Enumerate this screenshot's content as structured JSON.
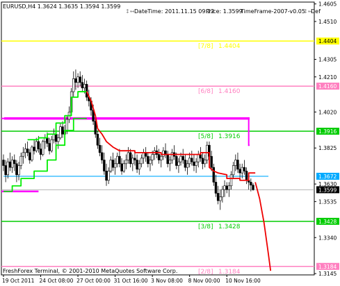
{
  "header": {
    "symbol_line": "EURUSD,H4  1.3624 1.3635 1.3594 1.3599",
    "datetime": "DateTime: 2011.11.15 09:22",
    "price": "Price: 1.3599",
    "timeframe": "TimeFrame-2007-v0.05",
    "extra": "Def"
  },
  "footer": {
    "copyright": "FreshForex Terminal, © 2001-2010 MetaQuotes Software Corp."
  },
  "colors": {
    "background": "#ffffff",
    "candles": "#000000",
    "murrey_78": "#ffff00",
    "murrey_68": "#ff80c0",
    "murrey_58": "#00cc00",
    "murrey_38": "#00cc00",
    "murrey_28": "#ff80c0",
    "magenta_band": "#ff00ff",
    "cyan_line": "#00aaff",
    "trailing_green": "#00ee00",
    "trailing_red": "#ee0000",
    "price_line": "#aaaaaa"
  },
  "chart_data": {
    "type": "candlestick",
    "symbol": "EURUSD",
    "timeframe": "H4",
    "ohlc_current": {
      "open": 1.3624,
      "high": 1.3635,
      "low": 1.3594,
      "close": 1.3599
    },
    "ylim": [
      1.3138,
      1.4615
    ],
    "y_ticks": [
      "1.4605",
      "1.4510",
      "1.4305",
      "1.4210",
      "1.4020",
      "1.3825",
      "1.3630",
      "1.3535",
      "1.3340",
      "1.3145"
    ],
    "x_ticks": [
      "19 Oct 2011",
      "24 Oct 08:00",
      "27 Oct 00:00",
      "31 Oct 16:00",
      "3 Nov 08:00",
      "8 Nov 00:00",
      "10 Nov 16:00"
    ],
    "murrey_levels": [
      {
        "label": "[7/8]",
        "value": 1.4404,
        "value_text": "1.4404",
        "color": "#ffff00"
      },
      {
        "label": "[6/8]",
        "value": 1.416,
        "value_text": "1.4160",
        "color": "#ff80c0"
      },
      {
        "label": "[5/8]",
        "value": 1.3916,
        "value_text": "1.3916",
        "color": "#00cc00"
      },
      {
        "label": "[3/8]",
        "value": 1.3428,
        "value_text": "1.3428",
        "color": "#00cc00"
      },
      {
        "label": "[2/8]",
        "value": 1.3184,
        "value_text": "1.3184",
        "color": "#ff80c0"
      }
    ],
    "price_tags": [
      {
        "value": 1.4404,
        "text": "1.4404",
        "bg": "#ffff00",
        "fg": "#000000"
      },
      {
        "value": 1.416,
        "text": "1.4160",
        "bg": "#ff80c0",
        "fg": "#ffffff"
      },
      {
        "value": 1.3916,
        "text": "1.3916",
        "bg": "#00cc00",
        "fg": "#ffffff"
      },
      {
        "value": 1.3672,
        "text": "1.3672",
        "bg": "#00aaff",
        "fg": "#ffffff"
      },
      {
        "value": 1.3599,
        "text": "1.3599",
        "bg": "#000000",
        "fg": "#ffffff"
      },
      {
        "value": 1.3428,
        "text": "1.3428",
        "bg": "#00cc00",
        "fg": "#ffffff"
      },
      {
        "value": 1.3184,
        "text": "1.3184",
        "bg": "#ff80c0",
        "fg": "#ffffff"
      }
    ],
    "magenta_band": {
      "value": 1.3985,
      "step_down": {
        "value": 1.384,
        "from_bar": 112
      },
      "left_stub": {
        "value": 1.359,
        "to_bar": 16
      }
    },
    "cyan_level": {
      "value": 1.3672,
      "from_bar": 0,
      "to_bar": 121
    },
    "current_price": 1.3599,
    "candles": [
      [
        1.376,
        1.379,
        1.37,
        1.373
      ],
      [
        1.373,
        1.376,
        1.364,
        1.368
      ],
      [
        1.368,
        1.377,
        1.366,
        1.375
      ],
      [
        1.375,
        1.38,
        1.37,
        1.372
      ],
      [
        1.372,
        1.378,
        1.369,
        1.376
      ],
      [
        1.376,
        1.379,
        1.37,
        1.374
      ],
      [
        1.374,
        1.376,
        1.364,
        1.368
      ],
      [
        1.368,
        1.375,
        1.365,
        1.373
      ],
      [
        1.373,
        1.38,
        1.371,
        1.378
      ],
      [
        1.378,
        1.383,
        1.374,
        1.38
      ],
      [
        1.38,
        1.385,
        1.377,
        1.382
      ],
      [
        1.382,
        1.386,
        1.378,
        1.38
      ],
      [
        1.38,
        1.382,
        1.374,
        1.376
      ],
      [
        1.376,
        1.384,
        1.375,
        1.383
      ],
      [
        1.383,
        1.387,
        1.379,
        1.381
      ],
      [
        1.381,
        1.388,
        1.38,
        1.386
      ],
      [
        1.386,
        1.389,
        1.38,
        1.382
      ],
      [
        1.382,
        1.385,
        1.376,
        1.379
      ],
      [
        1.379,
        1.387,
        1.378,
        1.386
      ],
      [
        1.386,
        1.39,
        1.382,
        1.388
      ],
      [
        1.388,
        1.391,
        1.383,
        1.385
      ],
      [
        1.385,
        1.388,
        1.379,
        1.381
      ],
      [
        1.381,
        1.389,
        1.38,
        1.387
      ],
      [
        1.387,
        1.393,
        1.385,
        1.39
      ],
      [
        1.39,
        1.392,
        1.384,
        1.386
      ],
      [
        1.386,
        1.39,
        1.382,
        1.388
      ],
      [
        1.388,
        1.396,
        1.387,
        1.394
      ],
      [
        1.394,
        1.397,
        1.388,
        1.39
      ],
      [
        1.39,
        1.395,
        1.387,
        1.392
      ],
      [
        1.392,
        1.4,
        1.39,
        1.398
      ],
      [
        1.398,
        1.405,
        1.396,
        1.402
      ],
      [
        1.402,
        1.415,
        1.4,
        1.413
      ],
      [
        1.413,
        1.424,
        1.41,
        1.42
      ],
      [
        1.42,
        1.425,
        1.414,
        1.418
      ],
      [
        1.418,
        1.423,
        1.415,
        1.421
      ],
      [
        1.421,
        1.424,
        1.416,
        1.418
      ],
      [
        1.418,
        1.422,
        1.413,
        1.415
      ],
      [
        1.415,
        1.42,
        1.412,
        1.417
      ],
      [
        1.417,
        1.419,
        1.408,
        1.41
      ],
      [
        1.41,
        1.414,
        1.405,
        1.408
      ],
      [
        1.408,
        1.41,
        1.4,
        1.403
      ],
      [
        1.403,
        1.406,
        1.395,
        1.397
      ],
      [
        1.397,
        1.399,
        1.388,
        1.39
      ],
      [
        1.39,
        1.392,
        1.382,
        1.384
      ],
      [
        1.384,
        1.388,
        1.378,
        1.38
      ],
      [
        1.38,
        1.384,
        1.374,
        1.376
      ],
      [
        1.376,
        1.38,
        1.368,
        1.37
      ],
      [
        1.37,
        1.374,
        1.362,
        1.365
      ],
      [
        1.365,
        1.372,
        1.363,
        1.37
      ],
      [
        1.37,
        1.378,
        1.369,
        1.376
      ],
      [
        1.376,
        1.38,
        1.37,
        1.372
      ],
      [
        1.372,
        1.377,
        1.368,
        1.374
      ],
      [
        1.374,
        1.38,
        1.372,
        1.378
      ],
      [
        1.378,
        1.382,
        1.372,
        1.374
      ],
      [
        1.374,
        1.377,
        1.368,
        1.37
      ],
      [
        1.37,
        1.376,
        1.369,
        1.374
      ],
      [
        1.374,
        1.379,
        1.371,
        1.376
      ],
      [
        1.376,
        1.383,
        1.374,
        1.38
      ],
      [
        1.38,
        1.382,
        1.372,
        1.374
      ],
      [
        1.374,
        1.379,
        1.37,
        1.377
      ],
      [
        1.377,
        1.381,
        1.373,
        1.376
      ],
      [
        1.376,
        1.379,
        1.369,
        1.371
      ],
      [
        1.371,
        1.376,
        1.368,
        1.374
      ],
      [
        1.374,
        1.379,
        1.372,
        1.377
      ],
      [
        1.377,
        1.382,
        1.374,
        1.38
      ],
      [
        1.38,
        1.383,
        1.375,
        1.378
      ],
      [
        1.378,
        1.38,
        1.372,
        1.374
      ],
      [
        1.374,
        1.378,
        1.37,
        1.376
      ],
      [
        1.376,
        1.381,
        1.373,
        1.379
      ],
      [
        1.379,
        1.383,
        1.376,
        1.381
      ],
      [
        1.381,
        1.384,
        1.377,
        1.379
      ],
      [
        1.379,
        1.382,
        1.374,
        1.376
      ],
      [
        1.376,
        1.38,
        1.372,
        1.378
      ],
      [
        1.378,
        1.383,
        1.376,
        1.381
      ],
      [
        1.381,
        1.385,
        1.377,
        1.379
      ],
      [
        1.379,
        1.381,
        1.372,
        1.374
      ],
      [
        1.374,
        1.378,
        1.37,
        1.376
      ],
      [
        1.376,
        1.382,
        1.374,
        1.38
      ],
      [
        1.38,
        1.384,
        1.376,
        1.378
      ],
      [
        1.378,
        1.38,
        1.371,
        1.373
      ],
      [
        1.373,
        1.377,
        1.369,
        1.375
      ],
      [
        1.375,
        1.38,
        1.373,
        1.378
      ],
      [
        1.378,
        1.382,
        1.374,
        1.376
      ],
      [
        1.376,
        1.379,
        1.37,
        1.372
      ],
      [
        1.372,
        1.376,
        1.368,
        1.374
      ],
      [
        1.374,
        1.38,
        1.372,
        1.377
      ],
      [
        1.377,
        1.381,
        1.373,
        1.375
      ],
      [
        1.375,
        1.379,
        1.37,
        1.373
      ],
      [
        1.373,
        1.377,
        1.369,
        1.375
      ],
      [
        1.375,
        1.381,
        1.372,
        1.379
      ],
      [
        1.379,
        1.383,
        1.375,
        1.377
      ],
      [
        1.377,
        1.38,
        1.371,
        1.374
      ],
      [
        1.374,
        1.379,
        1.372,
        1.376
      ],
      [
        1.376,
        1.386,
        1.374,
        1.384
      ],
      [
        1.384,
        1.386,
        1.376,
        1.378
      ],
      [
        1.378,
        1.381,
        1.37,
        1.372
      ],
      [
        1.372,
        1.374,
        1.362,
        1.364
      ],
      [
        1.364,
        1.368,
        1.356,
        1.358
      ],
      [
        1.358,
        1.362,
        1.352,
        1.354
      ],
      [
        1.354,
        1.36,
        1.349,
        1.356
      ],
      [
        1.356,
        1.362,
        1.353,
        1.36
      ],
      [
        1.36,
        1.365,
        1.356,
        1.362
      ],
      [
        1.362,
        1.364,
        1.358,
        1.36
      ],
      [
        1.36,
        1.364,
        1.356,
        1.362
      ],
      [
        1.362,
        1.37,
        1.36,
        1.368
      ],
      [
        1.368,
        1.375,
        1.366,
        1.373
      ],
      [
        1.373,
        1.379,
        1.37,
        1.376
      ],
      [
        1.376,
        1.38,
        1.369,
        1.371
      ],
      [
        1.371,
        1.374,
        1.365,
        1.369
      ],
      [
        1.369,
        1.374,
        1.366,
        1.372
      ],
      [
        1.372,
        1.376,
        1.368,
        1.37
      ],
      [
        1.37,
        1.372,
        1.363,
        1.365
      ],
      [
        1.365,
        1.368,
        1.36,
        1.364
      ],
      [
        1.364,
        1.366,
        1.359,
        1.3624
      ],
      [
        1.3624,
        1.3635,
        1.3594,
        1.3599
      ]
    ],
    "trailing_stop": [
      {
        "color": "#00ee00",
        "points": [
          [
            11,
            1.387
          ],
          [
            16,
            1.387
          ],
          [
            16,
            1.388
          ],
          [
            20,
            1.388
          ],
          [
            20,
            1.39
          ],
          [
            24,
            1.39
          ],
          [
            24,
            1.396
          ],
          [
            28,
            1.396
          ],
          [
            28,
            1.4
          ],
          [
            31,
            1.4
          ],
          [
            31,
            1.41
          ],
          [
            34,
            1.41
          ],
          [
            34,
            1.413
          ],
          [
            38,
            1.413
          ]
        ]
      },
      {
        "color": "#00ee00",
        "points": [
          [
            0,
            1.359
          ],
          [
            4,
            1.359
          ],
          [
            4,
            1.362
          ],
          [
            8,
            1.362
          ],
          [
            8,
            1.366
          ],
          [
            14,
            1.366
          ],
          [
            14,
            1.37
          ],
          [
            20,
            1.37
          ],
          [
            20,
            1.376
          ],
          [
            24,
            1.376
          ],
          [
            24,
            1.384
          ],
          [
            28,
            1.384
          ],
          [
            28,
            1.392
          ],
          [
            32,
            1.392
          ],
          [
            32,
            1.3985
          ],
          [
            38,
            1.3985
          ]
        ]
      },
      {
        "color": "#ee0000",
        "points": [
          [
            38,
            1.413
          ],
          [
            40,
            1.408
          ],
          [
            42,
            1.4
          ],
          [
            43,
            1.393
          ],
          [
            45,
            1.39
          ],
          [
            47,
            1.386
          ],
          [
            50,
            1.383
          ],
          [
            53,
            1.381
          ],
          [
            60,
            1.381
          ],
          [
            60,
            1.38
          ],
          [
            72,
            1.38
          ],
          [
            72,
            1.379
          ],
          [
            90,
            1.379
          ],
          [
            90,
            1.38
          ],
          [
            94,
            1.38
          ],
          [
            94,
            1.372
          ],
          [
            96,
            1.37
          ],
          [
            98,
            1.369
          ],
          [
            102,
            1.368
          ],
          [
            102,
            1.366
          ],
          [
            108,
            1.366
          ],
          [
            108,
            1.365
          ],
          [
            112,
            1.365
          ],
          [
            112,
            1.369
          ],
          [
            115,
            1.369
          ]
        ]
      },
      {
        "color": "#ee0000",
        "points": [
          [
            115,
            1.364
          ],
          [
            117,
            1.355
          ],
          [
            119,
            1.342
          ],
          [
            121,
            1.325
          ],
          [
            122,
            1.316
          ]
        ]
      }
    ]
  }
}
